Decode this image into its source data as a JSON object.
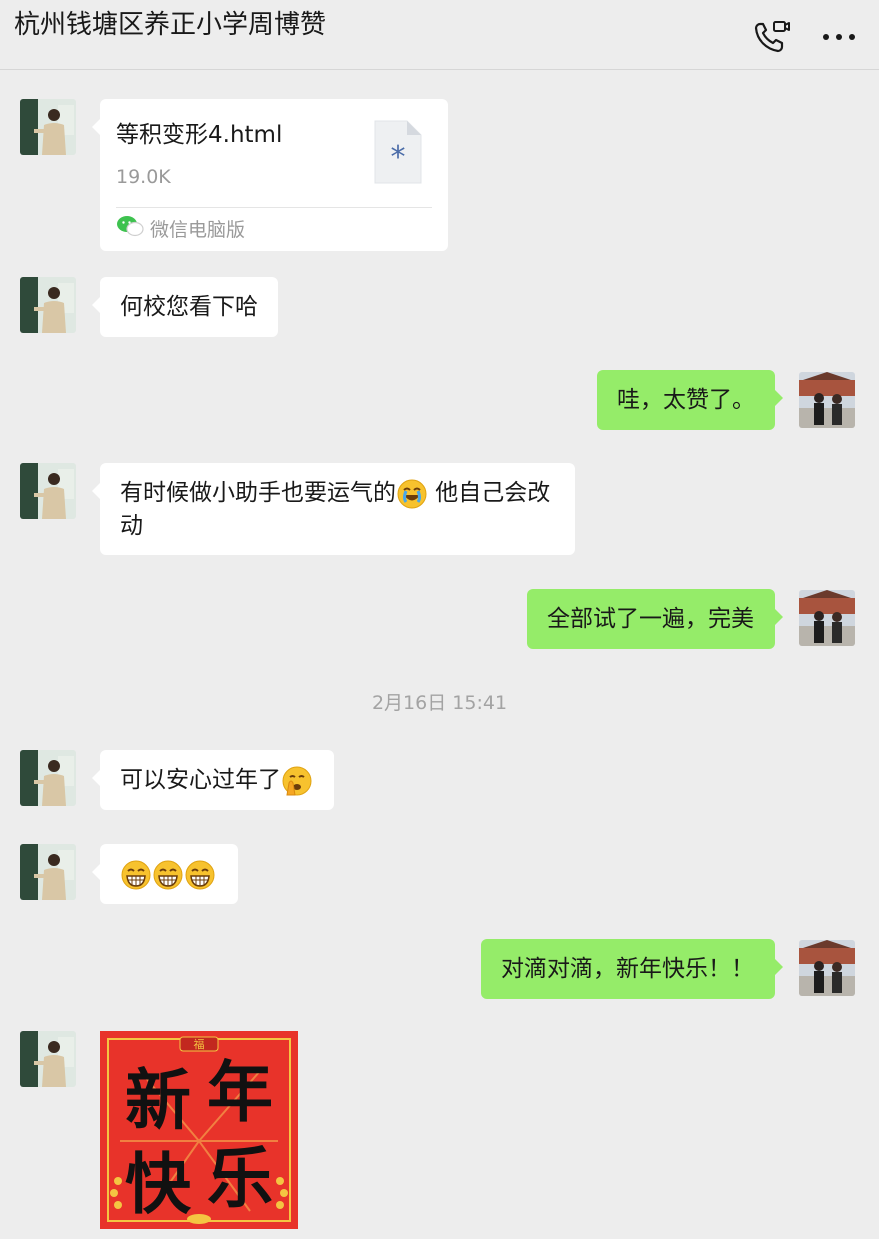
{
  "header": {
    "title": "杭州钱塘区养正小学周博赞",
    "call_icon": "phone-video-icon",
    "more_icon": "more-dots-icon"
  },
  "colors": {
    "background": "#ededed",
    "incoming_bubble": "#ffffff",
    "outgoing_bubble": "#95ec69",
    "sticker_red": "#e8332a"
  },
  "messages": {
    "m1": {
      "sender": "contact",
      "type": "file",
      "file_name": "等积变形4.html",
      "file_size": "19.0K",
      "source_label": "微信电脑版",
      "source_icon": "wechat-icon"
    },
    "m2": {
      "sender": "contact",
      "text": "何校您看下哈"
    },
    "m3": {
      "sender": "self",
      "text": "哇，太赞了。"
    },
    "m4": {
      "sender": "contact",
      "text_before": "有时候做小助手也要运气的",
      "emoji": "sweat-laugh-emoji",
      "text_after": " 他自己会改动"
    },
    "m5": {
      "sender": "self",
      "text": "全部试了一遍，完美"
    },
    "timestamp": "2月16日 15:41",
    "m6": {
      "sender": "contact",
      "text": "可以安心过年了",
      "emoji": "shush-emoji"
    },
    "m7": {
      "sender": "contact",
      "emojis": [
        "grin-emoji",
        "grin-emoji",
        "grin-emoji"
      ]
    },
    "m8": {
      "sender": "self",
      "text": "对滴对滴，新年快乐！！"
    },
    "m9": {
      "sender": "contact",
      "type": "sticker",
      "sticker_top_text": "福",
      "sticker_text": [
        "新",
        "年",
        "快",
        "乐"
      ]
    }
  }
}
